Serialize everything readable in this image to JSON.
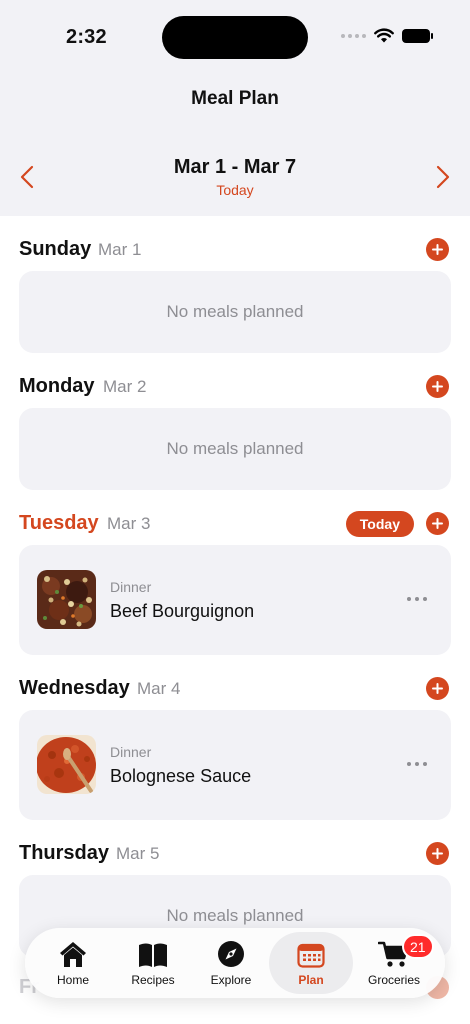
{
  "status": {
    "time": "2:32"
  },
  "header": {
    "title": "Meal Plan",
    "week_range": "Mar 1 - Mar 7",
    "week_sub": "Today"
  },
  "days": [
    {
      "name": "Sunday",
      "date": "Mar 1",
      "empty_text": "No meals planned"
    },
    {
      "name": "Monday",
      "date": "Mar 2",
      "empty_text": "No meals planned"
    },
    {
      "name": "Tuesday",
      "date": "Mar 3",
      "today_label": "Today",
      "meal": {
        "type": "Dinner",
        "name": "Beef Bourguignon"
      }
    },
    {
      "name": "Wednesday",
      "date": "Mar 4",
      "meal": {
        "type": "Dinner",
        "name": "Bolognese Sauce"
      }
    },
    {
      "name": "Thursday",
      "date": "Mar 5",
      "empty_text": "No meals planned"
    },
    {
      "name": "Fr"
    }
  ],
  "tabs": [
    {
      "label": "Home",
      "icon": "house-icon"
    },
    {
      "label": "Recipes",
      "icon": "book-icon"
    },
    {
      "label": "Explore",
      "icon": "compass-icon"
    },
    {
      "label": "Plan",
      "icon": "calendar-icon",
      "active": true
    },
    {
      "label": "Groceries",
      "icon": "cart-icon",
      "badge": "21"
    }
  ],
  "colors": {
    "accent": "#d4471f",
    "badge": "#ff2b2b",
    "card": "#f2f2f6"
  }
}
